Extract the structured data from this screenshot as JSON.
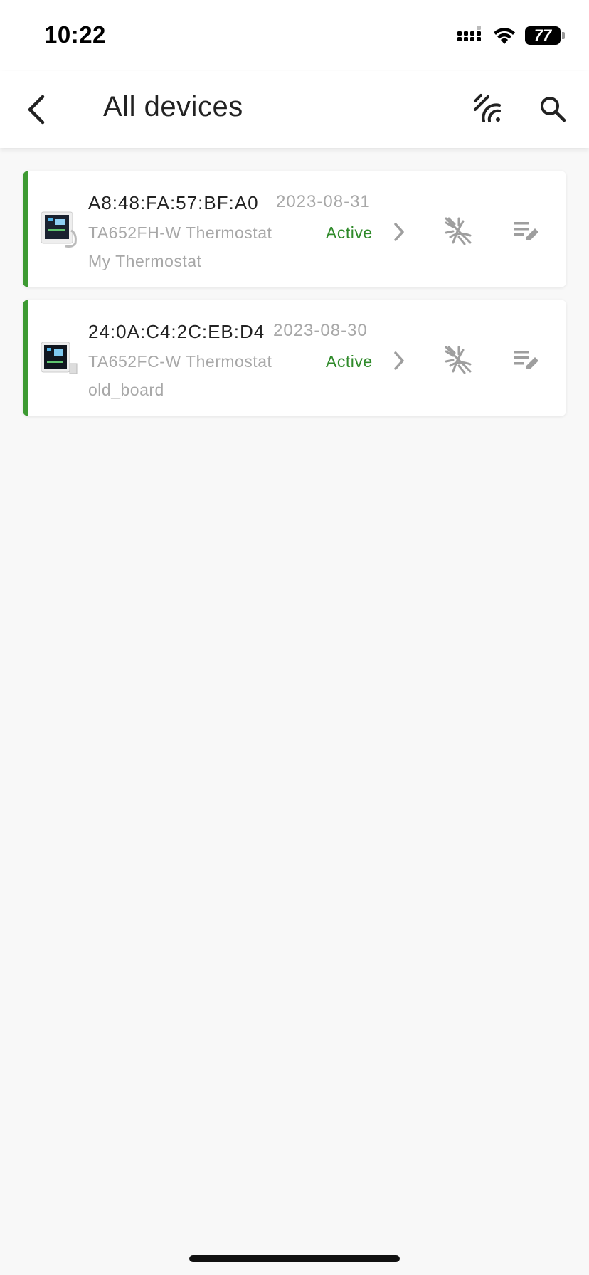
{
  "status_bar": {
    "time": "10:22",
    "battery": "77",
    "icons": [
      "signal-icon",
      "wifi-icon",
      "battery-icon"
    ]
  },
  "header": {
    "title": "All devices",
    "icons": [
      "back-arrow-icon",
      "scan-signal-icon",
      "search-icon"
    ]
  },
  "colors": {
    "accent": "#3d9a32",
    "status_active": "#2f8a2a",
    "muted_text": "#a8a8a8",
    "icon_gray": "#9e9e9e",
    "background": "#f8f8f8"
  },
  "devices": [
    {
      "mac": "A8:48:FA:57:BF:A0",
      "date": "2023-08-31",
      "model": "TA652FH-W Thermostat",
      "status": "Active",
      "name": "My Thermostat"
    },
    {
      "mac": "24:0A:C4:2C:EB:D4",
      "date": "2023-08-30",
      "model": "TA652FC-W Thermostat",
      "status": "Active",
      "name": "old_board"
    }
  ]
}
